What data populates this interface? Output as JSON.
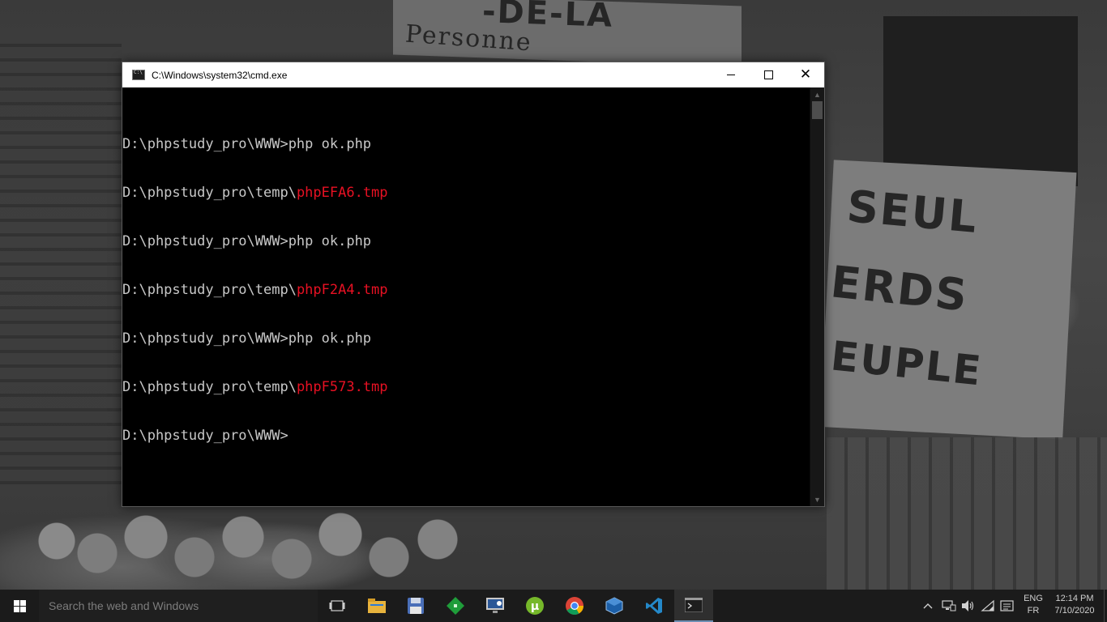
{
  "window": {
    "title": "C:\\Windows\\system32\\cmd.exe",
    "controls": {
      "minimize_icon": "minimize-icon",
      "maximize_icon": "maximize-icon",
      "close_icon": "close-icon"
    }
  },
  "console": {
    "lines": [
      {
        "prefix": "D:\\phpstudy_pro\\WWW>php ok.php",
        "highlight": ""
      },
      {
        "prefix": "D:\\phpstudy_pro\\temp\\",
        "highlight": "phpEFA6.tmp"
      },
      {
        "prefix": "D:\\phpstudy_pro\\WWW>php ok.php",
        "highlight": ""
      },
      {
        "prefix": "D:\\phpstudy_pro\\temp\\",
        "highlight": "phpF2A4.tmp"
      },
      {
        "prefix": "D:\\phpstudy_pro\\WWW>php ok.php",
        "highlight": ""
      },
      {
        "prefix": "D:\\phpstudy_pro\\temp\\",
        "highlight": "phpF573.tmp"
      },
      {
        "prefix": "D:\\phpstudy_pro\\WWW>",
        "highlight": ""
      }
    ],
    "highlight_color": "#e81123",
    "text_color": "#c8c8c8"
  },
  "wallpaper": {
    "sign_top_text": "-DE-LA",
    "sign_top_sub": "Personne",
    "sign_right_lines": [
      "SEUL",
      "ERDS",
      "EUPLE"
    ]
  },
  "taskbar": {
    "search_placeholder": "Search the web and Windows",
    "icons": [
      {
        "name": "task-view-icon"
      },
      {
        "name": "file-explorer-icon"
      },
      {
        "name": "save-disk-icon"
      },
      {
        "name": "green-diamond-app-icon"
      },
      {
        "name": "remote-desktop-icon"
      },
      {
        "name": "utorrent-icon"
      },
      {
        "name": "chrome-icon"
      },
      {
        "name": "virtualbox-icon"
      },
      {
        "name": "vscode-icon"
      },
      {
        "name": "cmd-icon"
      }
    ],
    "tray": {
      "chevron_icon": "chevron-up-icon",
      "network_icon": "network-icon",
      "volume_icon": "volume-icon",
      "wifi_icon": "wifi-icon",
      "keyboard_icon": "keyboard-icon",
      "lang_primary": "ENG",
      "lang_secondary": "FR",
      "time": "12:14 PM",
      "date": "7/10/2020"
    },
    "accent_color": "#6d8fb3"
  }
}
